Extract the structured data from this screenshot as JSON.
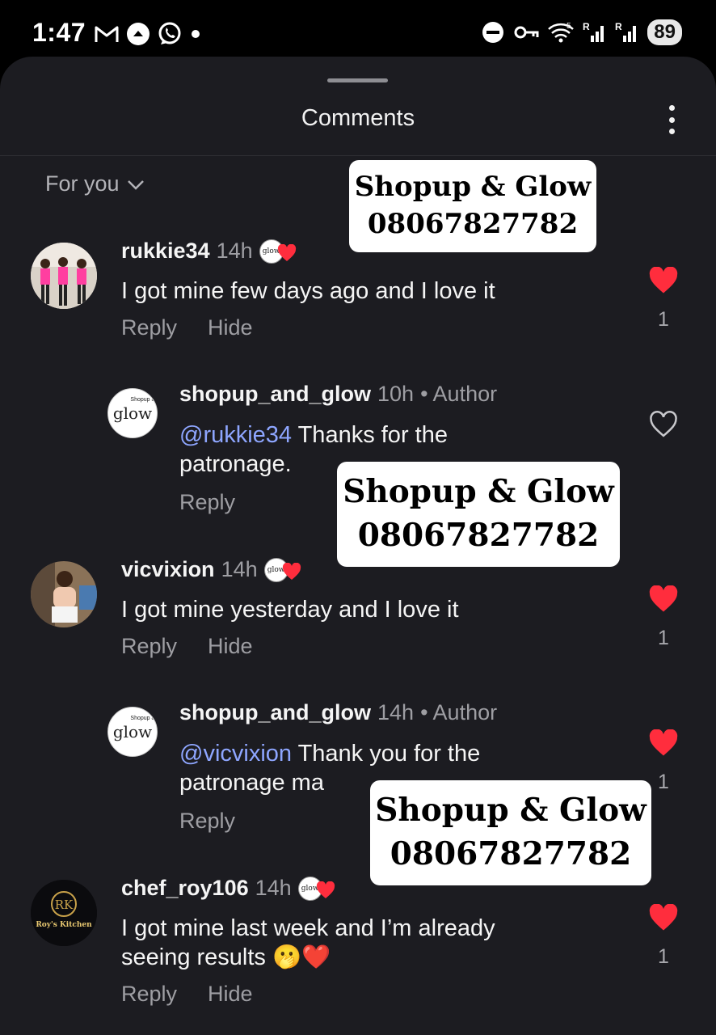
{
  "status_bar": {
    "time": "1:47",
    "left_icons": [
      "gmail-icon",
      "upload-icon",
      "whatsapp-icon",
      "dot-icon"
    ],
    "right_icons": [
      "do-not-disturb-icon",
      "vpn-key-icon",
      "wifi-icon",
      "signal-icon",
      "signal-icon"
    ],
    "battery": "89"
  },
  "sheet": {
    "title": "Comments",
    "filter_label": "For you"
  },
  "comments": [
    {
      "user": "rukkie34",
      "time": "14h",
      "text": "I got mine few days ago and I love it",
      "reply_label": "Reply",
      "hide_label": "Hide",
      "liked": true,
      "like_count": "1"
    },
    {
      "user": "shopup_and_glow",
      "time": "10h",
      "author_label": "• Author",
      "mention": "@rukkie34",
      "text": " Thanks for the",
      "text_line2": "patronage.",
      "reply_label": "Reply",
      "liked": false,
      "like_count": ""
    },
    {
      "user": "vicvixion",
      "time": "14h",
      "text": "I got mine yesterday and I love it",
      "reply_label": "Reply",
      "hide_label": "Hide",
      "liked": true,
      "like_count": "1"
    },
    {
      "user": "shopup_and_glow",
      "time": "14h",
      "author_label": "• Author",
      "mention": "@vicvixion",
      "text": " Thank you for the",
      "text_line2": "patronage ma",
      "reply_label": "Reply",
      "liked": true,
      "like_count": "1"
    },
    {
      "user": "chef_roy106",
      "time": "14h",
      "text": "I got mine last week and I’m already",
      "text_line2": "seeing results 🫢❤️",
      "reply_label": "Reply",
      "hide_label": "Hide",
      "liked": true,
      "like_count": "1"
    }
  ],
  "watermark": {
    "line1": "Shopup & Glow",
    "line2": "08067827782"
  },
  "logo_text": "glow",
  "logo_small": "Shopup &",
  "rk_logo": {
    "initials": "RK",
    "name": "Roy's Kitchen"
  },
  "colors": {
    "sheet_bg": "#1c1c21",
    "heart_red": "#ff2d3d",
    "mention_blue": "#8ea6ff",
    "muted_text": "#9e9ea3"
  }
}
